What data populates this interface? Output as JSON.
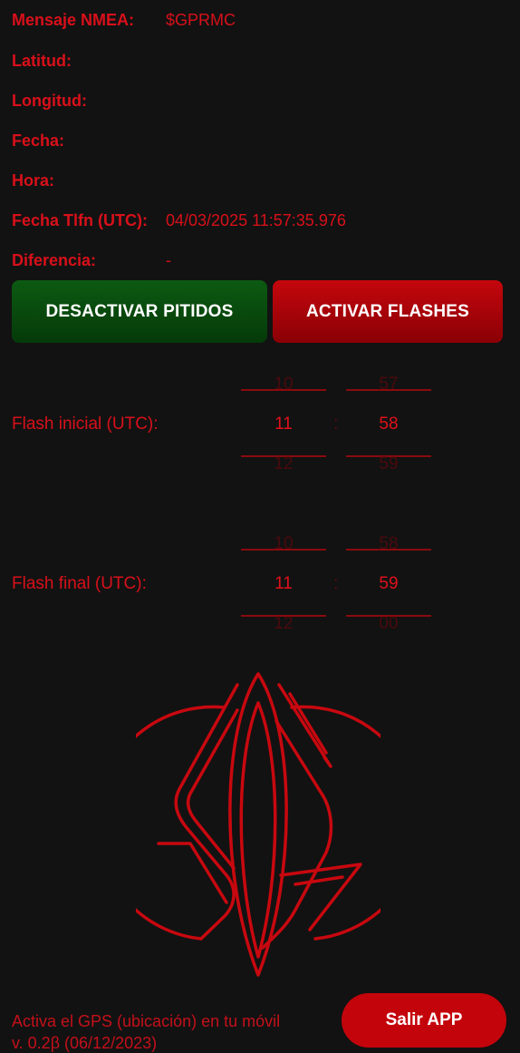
{
  "info": {
    "nmea_label": "Mensaje NMEA:",
    "nmea_value": "$GPRMC",
    "lat_label": "Latitud:",
    "lon_label": "Longitud:",
    "date_label": "Fecha:",
    "time_label": "Hora:",
    "phone_label": "Fecha Tlfn (UTC):",
    "phone_value": "04/03/2025 11:57:35.976",
    "diff_label": "Diferencia:",
    "diff_value": "-"
  },
  "buttons": {
    "beeps": "DESACTIVAR PITIDOS",
    "flashes": "ACTIVAR FLASHES",
    "exit": "Salir APP"
  },
  "flash_start": {
    "label": "Flash inicial (UTC):",
    "hour_prev": "10",
    "hour": "11",
    "hour_next": "12",
    "min_prev": "57",
    "min": "58",
    "min_next": "59",
    "sep": ":"
  },
  "flash_end": {
    "label": "Flash final (UTC):",
    "hour_prev": "10",
    "hour": "11",
    "hour_next": "12",
    "min_prev": "58",
    "min": "59",
    "min_next": "00",
    "sep": ":"
  },
  "footer": {
    "gps_hint": "Activa el GPS (ubicación) en tu móvil",
    "version": "v. 0.2β (06/12/2023)"
  },
  "colors": {
    "accent_red": "#d8101a",
    "green_button": "#0c5a12",
    "red_button": "#c4070d",
    "background": "#121212"
  }
}
